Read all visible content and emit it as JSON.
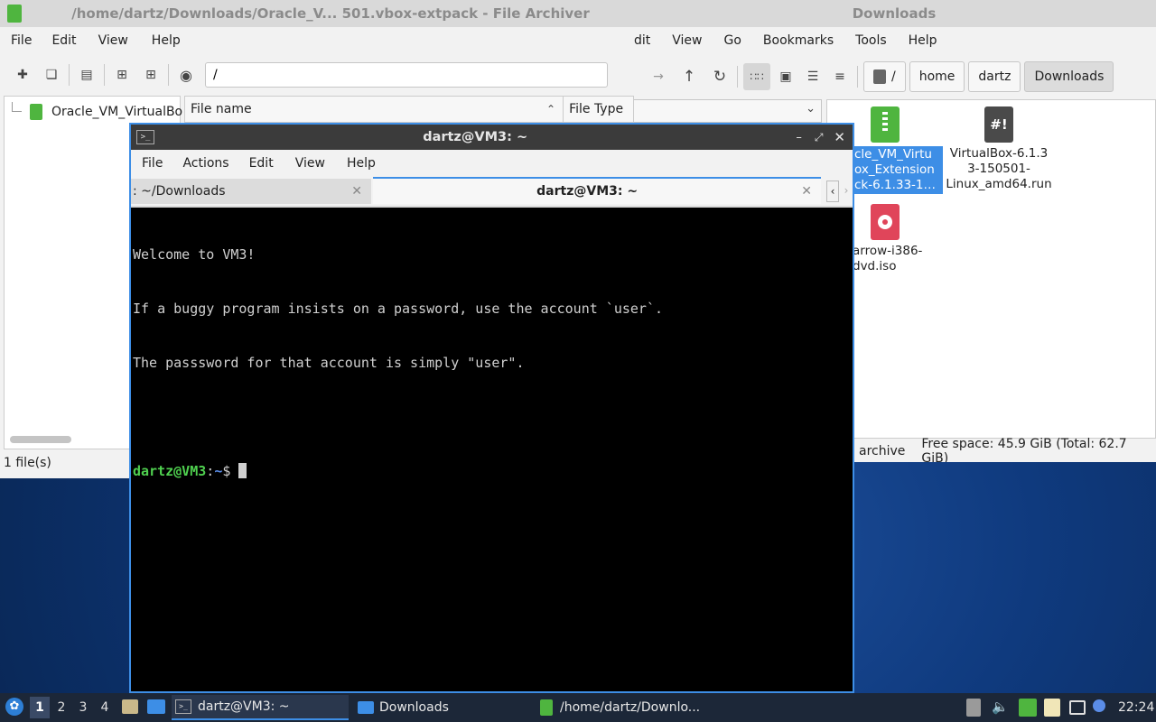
{
  "archiver": {
    "title": "/home/dartz/Downloads/Oracle_V... 501.vbox-extpack - File Archiver",
    "menu": [
      "File",
      "Edit",
      "View",
      "Help"
    ],
    "path_value": "/",
    "tree_item": "Oracle_VM_VirtualBo",
    "col_filename": "File name",
    "col_filetype": "File Type",
    "status": "1 file(s)"
  },
  "filemanager": {
    "title": "Downloads",
    "menu": [
      "dit",
      "View",
      "Go",
      "Bookmarks",
      "Tools",
      "Help"
    ],
    "breadcrumbs": [
      "/",
      "home",
      "dartz",
      "Downloads"
    ],
    "files": [
      {
        "name": "cle_VM_Virtu\nox_Extension\nck-6.1.33-1…",
        "icon": "archive-icon",
        "color": "#4fb53f"
      },
      {
        "name": "VirtualBox-6.1.3\n3-150501-\nLinux_amd64.run",
        "icon": "script-icon",
        "color": "#4a4a4a"
      },
      {
        "name": "arrow-i386-\ndvd.iso",
        "icon": "disc-image-icon",
        "color": "#e0455a"
      }
    ],
    "status_left": "archive",
    "status_right": "Free space: 45.9 GiB (Total: 62.7 GiB)"
  },
  "terminal": {
    "title": "dartz@VM3: ~",
    "menu": [
      "File",
      "Actions",
      "Edit",
      "View",
      "Help"
    ],
    "tabs": [
      ": ~/Downloads",
      "dartz@VM3: ~"
    ],
    "lines": [
      "Welcome to VM3!",
      "If a buggy program insists on a password, use the account `user`.",
      "The passsword for that account is simply \"user\"."
    ],
    "prompt_user": "dartz@VM3",
    "prompt_sep": ":",
    "prompt_path": "~",
    "prompt_end": "$"
  },
  "taskbar": {
    "workspaces": [
      "1",
      "2",
      "3",
      "4"
    ],
    "tasks": [
      "dartz@VM3: ~",
      "Downloads",
      "/home/dartz/Downlo..."
    ],
    "clock": "22:24"
  },
  "colors": {
    "accent": "#3d8ee6",
    "prompt_green": "#4fd04f",
    "prompt_blue": "#5b8de8",
    "selection": "#3d8ee6"
  }
}
